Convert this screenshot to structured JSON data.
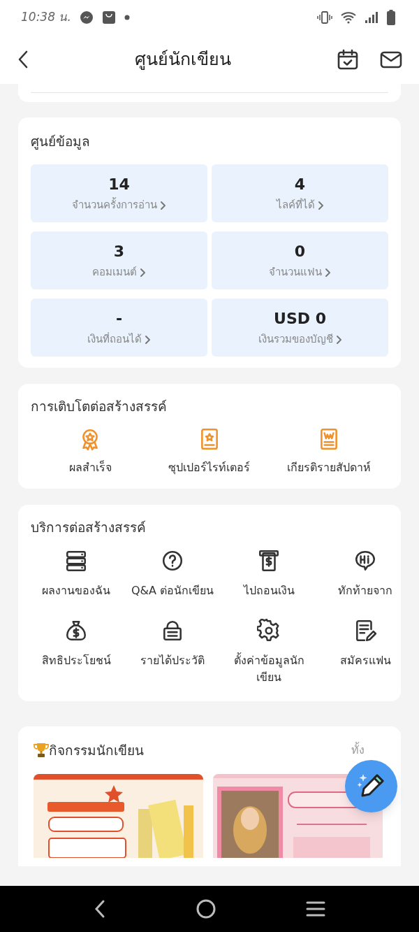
{
  "status_bar": {
    "time": "10:38 น."
  },
  "header": {
    "title": "ศูนย์นักเขียน"
  },
  "data_center": {
    "title": "ศูนย์ข้อมูล",
    "stats": [
      {
        "value": "14",
        "label": "จำนวนครั้งการอ่าน"
      },
      {
        "value": "4",
        "label": "ไลค์ที่ได้"
      },
      {
        "value": "3",
        "label": "คอมเมนต์"
      },
      {
        "value": "0",
        "label": "จำนวนแฟน"
      },
      {
        "value": "-",
        "label": "เงินที่ถอนได้"
      },
      {
        "value": "USD 0",
        "label": "เงินรวมของบัญชี"
      }
    ]
  },
  "growth": {
    "title": "การเติบโตต่อสร้างสรรค์",
    "items": [
      {
        "kind": "medal",
        "label": "ผลสำเร็จ"
      },
      {
        "kind": "badge",
        "label": "ซุปเปอร์ไรท์เตอร์"
      },
      {
        "kind": "document",
        "label": "เกียรติรายสัปดาห์"
      }
    ]
  },
  "services": {
    "title": "บริการต่อสร้างสรรค์",
    "items": [
      {
        "kind": "stack",
        "label": "ผลงานของฉัน"
      },
      {
        "kind": "question",
        "label": "Q&A ต่อนักเขียน"
      },
      {
        "kind": "withdraw",
        "label": "ไปถอนเงิน"
      },
      {
        "kind": "hi",
        "label": "ทักท้ายจาก"
      },
      {
        "kind": "moneybag",
        "label": "สิทธิประโยชน์"
      },
      {
        "kind": "lock",
        "label": "รายได้ประวัติ"
      },
      {
        "kind": "gear",
        "label": "ตั้งค่าข้อมูลนักเขียน"
      },
      {
        "kind": "note",
        "label": "สมัครแฟน"
      }
    ]
  },
  "activities": {
    "title": "กิจกรรมนักเขียน",
    "more": "ทั้ง"
  }
}
